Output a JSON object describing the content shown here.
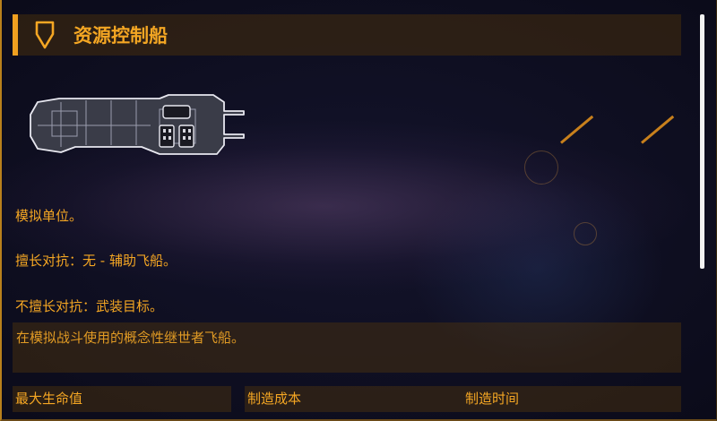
{
  "header": {
    "title": "资源控制船",
    "icon": "shield-pennant-icon"
  },
  "ship_image": "resource-controller-ship",
  "description": {
    "line1": "模拟单位。",
    "line2": "擅长对抗：无 - 辅助飞船。",
    "line3": "不擅长对抗：武装目标。"
  },
  "flavor_text": "在模拟战斗使用的概念性继世者飞船。",
  "stats": {
    "max_hp_label": "最大生命值",
    "build_cost_label": "制造成本",
    "build_time_label": "制造时间"
  },
  "colors": {
    "accent": "#f4a623",
    "panel": "#3a2a10",
    "background": "#0a0a1a"
  }
}
